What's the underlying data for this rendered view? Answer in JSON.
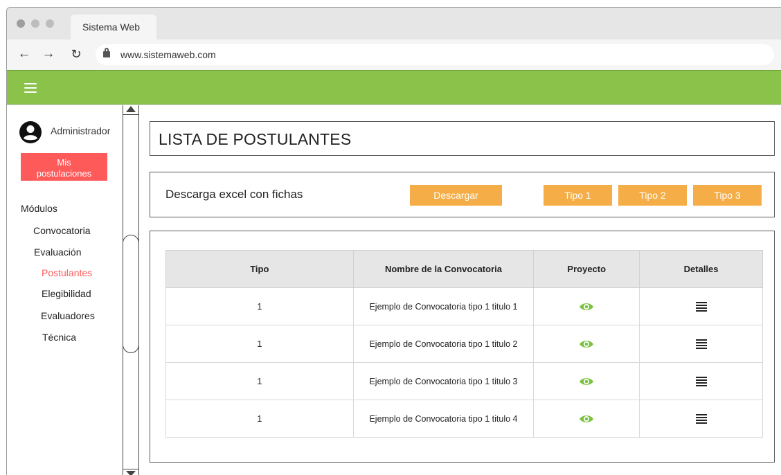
{
  "browser": {
    "tab_title": "Sistema Web",
    "url": "www.sistemaweb.com"
  },
  "icons": {
    "back": "arrow-left-icon",
    "forward": "arrow-right-icon",
    "reload": "reload-icon",
    "lock": "lock-icon",
    "menu": "hamburger-icon",
    "user": "user-circle-icon",
    "view": "eye-icon",
    "details": "list-icon"
  },
  "colors": {
    "appbar": "#8bc34a",
    "primary_button": "#ff5a5a",
    "action_button": "#f5ae47",
    "eye": "#7cc242"
  },
  "sidebar": {
    "user_name": "Administrador",
    "mis_postulaciones_line1": "Mis",
    "mis_postulaciones_line2": "postulaciones",
    "modules_heading": "Módulos",
    "items": [
      {
        "label": "Convocatoria"
      },
      {
        "label": "Evaluación"
      },
      {
        "label": "Postulantes",
        "active": true
      },
      {
        "label": "Elegibilidad"
      },
      {
        "label": "Evaluadores"
      },
      {
        "label": "Técnica"
      }
    ]
  },
  "main": {
    "title": "LISTA DE POSTULANTES",
    "download_label": "Descarga excel con fichas",
    "download_button": "Descargar",
    "type_buttons": [
      "Tipo 1",
      "Tipo 2",
      "Tipo 3"
    ],
    "table": {
      "headers": [
        "Tipo",
        "Nombre de la Convocatoria",
        "Proyecto",
        "Detalles"
      ],
      "rows": [
        {
          "tipo": "1",
          "nombre": "Ejemplo de Convocatoria tipo 1 titulo 1"
        },
        {
          "tipo": "1",
          "nombre": "Ejemplo de Convocatoria tipo 1 titulo 2"
        },
        {
          "tipo": "1",
          "nombre": "Ejemplo de Convocatoria tipo 1 titulo 3"
        },
        {
          "tipo": "1",
          "nombre": "Ejemplo de Convocatoria tipo 1 titulo 4"
        }
      ]
    }
  }
}
